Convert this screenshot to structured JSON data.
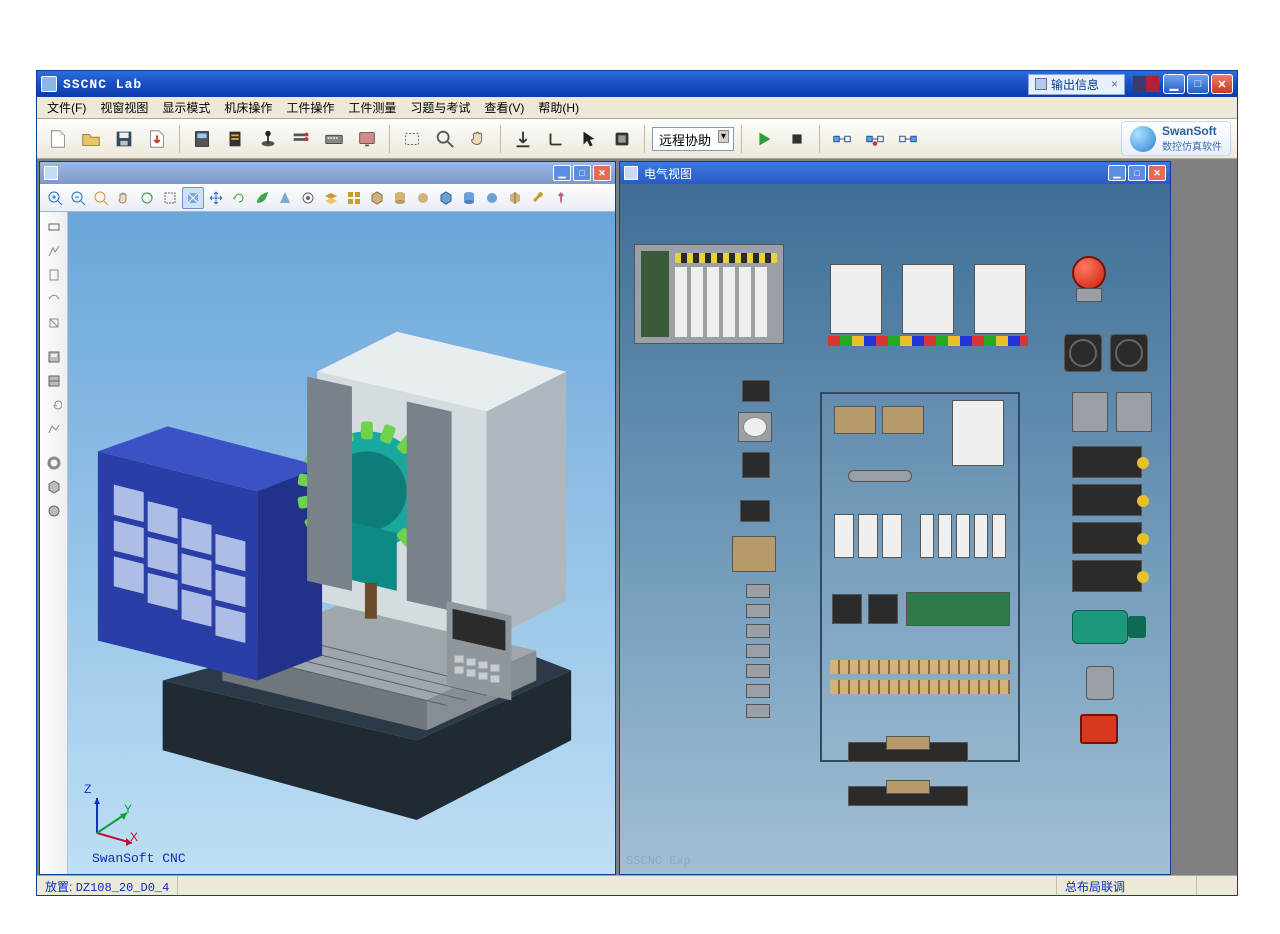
{
  "window": {
    "title": "SSCNC Lab",
    "float_info_label": "输出信息",
    "min_tip": "Minimize",
    "max_tip": "Maximize",
    "close_tip": "Close"
  },
  "menu": {
    "file": "文件(F)",
    "viewport": "视窗视图",
    "display_mode": "显示模式",
    "machine_ops": "机床操作",
    "workpiece_ops": "工件操作",
    "workpiece_measure": "工件测量",
    "practice_exam": "习题与考试",
    "view": "查看(V)",
    "help": "帮助(H)"
  },
  "toolbar": {
    "combo_value": "远程协助",
    "brand_en": "SwanSoft",
    "brand_cn": "数控仿真软件",
    "icons": {
      "new": "new-file-icon",
      "open": "open-file-icon",
      "save": "save-icon",
      "export": "export-icon",
      "panel1": "panel-icon",
      "panel2": "panel2-icon",
      "joystick": "joystick-icon",
      "door": "door-icon",
      "keyboard": "keyboard-icon",
      "screen": "screen-icon",
      "rect_sel": "rect-select-icon",
      "zoom": "magnifier-icon",
      "pan": "pan-hand-icon",
      "download": "download-icon",
      "angle": "angle-icon",
      "pointer": "pointer-icon",
      "stock": "stock-icon",
      "play": "play-icon",
      "stop": "stop-icon",
      "link1": "link-left-icon",
      "link2": "link-dot-icon",
      "link3": "link-right-icon"
    }
  },
  "cnc_view": {
    "title": "",
    "watermark": "SwanSoft CNC",
    "axis_x": "X",
    "axis_y": "Y",
    "axis_z": "Z"
  },
  "elec_view": {
    "title": "电气视图",
    "watermark": "SSCNC Exp"
  },
  "statusbar": {
    "left_label": "放置:",
    "left_value": "DZ108_20_D0_4",
    "right_value": "总布局联调"
  }
}
